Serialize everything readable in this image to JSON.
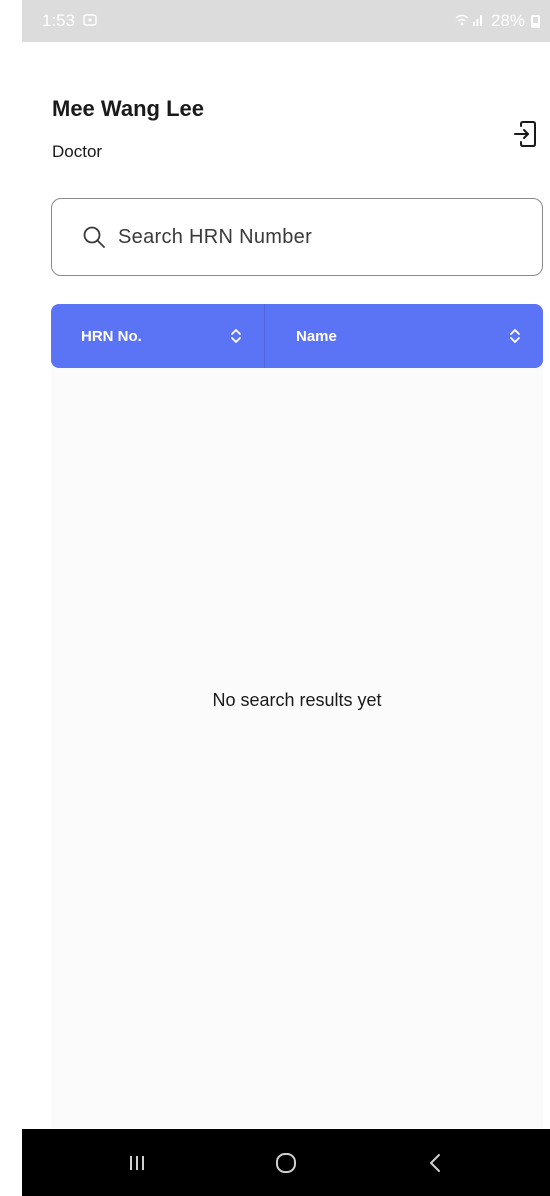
{
  "status_bar": {
    "time": "1:53",
    "notification_icon": "screenshot-icon",
    "signal_icons": "wifi-signal-icons",
    "battery_percent": "28%"
  },
  "header": {
    "user_name": "Mee Wang Lee",
    "user_role": "Doctor",
    "logout_icon": "logout-icon"
  },
  "search": {
    "placeholder": "Search HRN Number",
    "value": ""
  },
  "table": {
    "columns": [
      {
        "label": "HRN No.",
        "sort_icon": "sort-icon"
      },
      {
        "label": "Name",
        "sort_icon": "sort-icon"
      }
    ],
    "header_color": "#5b73f5",
    "rows": []
  },
  "results": {
    "empty_message": "No search results yet"
  },
  "nav_bar": {
    "buttons": [
      "recent-apps-icon",
      "home-icon",
      "back-icon"
    ]
  }
}
